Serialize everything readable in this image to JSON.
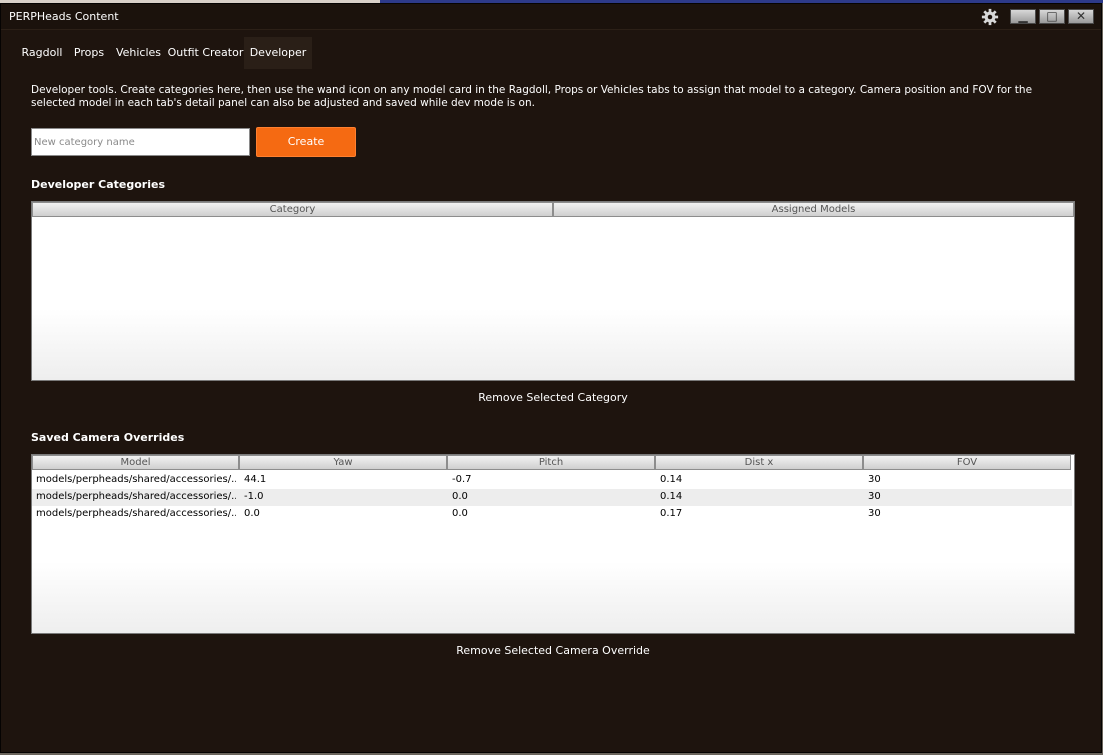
{
  "window": {
    "title": "PERPHeads Content",
    "icons": {
      "settings": "gear-icon",
      "minimize": "minimize-icon",
      "maximize": "maximize-icon",
      "close": "close-icon"
    }
  },
  "tabs": [
    {
      "label": "Ragdoll"
    },
    {
      "label": "Props"
    },
    {
      "label": "Vehicles"
    },
    {
      "label": "Outfit Creator"
    },
    {
      "label": "Developer",
      "active": true
    }
  ],
  "developer": {
    "description": "Developer tools. Create categories here, then use the wand icon on any model card in the Ragdoll, Props or Vehicles tabs to assign that model to a category. Camera position and FOV for the selected model in each tab's detail panel can also be adjusted and saved while dev mode is on.",
    "category_input": {
      "placeholder": "New category name",
      "value": ""
    },
    "create_label": "Create",
    "categories": {
      "title": "Developer Categories",
      "columns": [
        "Category",
        "Assigned Models"
      ],
      "rows": [],
      "remove_label": "Remove Selected Category"
    },
    "camera_overrides": {
      "title": "Saved Camera Overrides",
      "columns": [
        "Model",
        "Yaw",
        "Pitch",
        "Dist x",
        "FOV"
      ],
      "rows": [
        {
          "model": "models/perpheads/shared/accessories/...",
          "yaw": "44.1",
          "pitch": "-0.7",
          "dist": "0.14",
          "fov": "30"
        },
        {
          "model": "models/perpheads/shared/accessories/...",
          "yaw": "-1.0",
          "pitch": "0.0",
          "dist": "0.14",
          "fov": "30"
        },
        {
          "model": "models/perpheads/shared/accessories/...",
          "yaw": "0.0",
          "pitch": "0.0",
          "dist": "0.17",
          "fov": "30"
        }
      ],
      "remove_label": "Remove Selected Camera Override"
    }
  },
  "colors": {
    "accent": "#f56a12",
    "window_bg": "#1e140e"
  }
}
